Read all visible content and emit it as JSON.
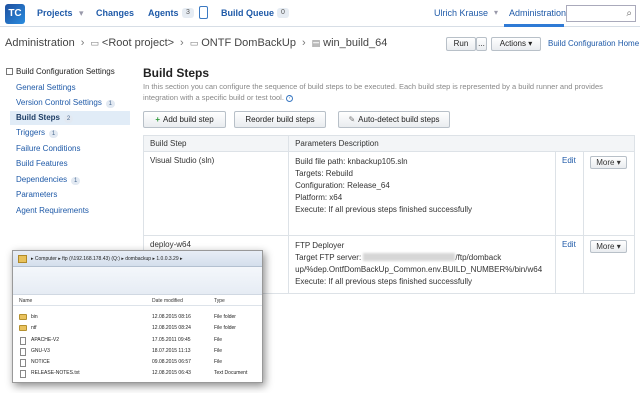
{
  "topbar": {
    "logo": "TC",
    "projects": "Projects",
    "changes": "Changes",
    "agents": "Agents",
    "agents_count": "3",
    "build_queue": "Build Queue",
    "queue_count": "0",
    "user": "Ulrich Krause",
    "administration": "Administration",
    "search_value": ""
  },
  "breadcrumb": {
    "admin": "Administration",
    "root": "<Root project>",
    "project": "ONTF DomBackUp",
    "config": "win_build_64"
  },
  "header_buttons": {
    "run": "Run",
    "run_more": "...",
    "actions": "Actions",
    "home": "Build Configuration Home"
  },
  "sidebar": {
    "heading": "Build Configuration Settings",
    "items": [
      {
        "label": "General Settings",
        "count": ""
      },
      {
        "label": "Version Control Settings",
        "count": "1"
      },
      {
        "label": "Build Steps",
        "count": "2"
      },
      {
        "label": "Triggers",
        "count": "1"
      },
      {
        "label": "Failure Conditions",
        "count": ""
      },
      {
        "label": "Build Features",
        "count": ""
      },
      {
        "label": "Dependencies",
        "count": "1"
      },
      {
        "label": "Parameters",
        "count": ""
      },
      {
        "label": "Agent Requirements",
        "count": ""
      }
    ]
  },
  "main": {
    "title": "Build Steps",
    "description": "In this section you can configure the sequence of build steps to be executed. Each build step is represented by a build runner and provides integration with a specific build or test tool.",
    "add_step": "Add build step",
    "reorder": "Reorder build steps",
    "auto_detect": "Auto-detect build steps",
    "col_step": "Build Step",
    "col_params": "Parameters Description",
    "steps": [
      {
        "name": "Visual Studio (sln)",
        "params": [
          "Build file path: knbackup105.sln",
          "Targets: Rebuild",
          "Configuration: Release_64",
          "Platform: x64",
          "Execute: If all previous steps finished successfully"
        ],
        "edit": "Edit",
        "more": "More"
      },
      {
        "name": "deploy-w64",
        "params": [
          "FTP Deployer",
          "Target FTP server:",
          "/ftp/domback",
          "up/%dep.OntfDomBackUp_Common.env.BUILD_NUMBER%/bin/w64",
          "Execute: If all previous steps finished successfully"
        ],
        "edit": "Edit",
        "more": "More"
      }
    ]
  },
  "explorer": {
    "path": "▸ Computer ▸ ftp (\\\\192.168.178.43) (Q:) ▸ dombackup ▸ 1.0.0.3.29 ▸",
    "col_name": "Name",
    "col_date": "Date modified",
    "col_type": "Type",
    "rows": [
      {
        "name": "bin",
        "date": "12.08.2015 08:16",
        "type": "File folder",
        "kind": "folder"
      },
      {
        "name": "ntf",
        "date": "12.08.2015 08:24",
        "type": "File folder",
        "kind": "folder"
      },
      {
        "name": "APACHE-V2",
        "date": "17.05.2011 09:45",
        "type": "File",
        "kind": "file"
      },
      {
        "name": "GNU-V3",
        "date": "18.07.2015 11:13",
        "type": "File",
        "kind": "file"
      },
      {
        "name": "NOTICE",
        "date": "09.08.2015 06:57",
        "type": "File",
        "kind": "file"
      },
      {
        "name": "RELEASE-NOTES.txt",
        "date": "12.08.2015 06:43",
        "type": "Text Document",
        "kind": "file"
      }
    ]
  }
}
